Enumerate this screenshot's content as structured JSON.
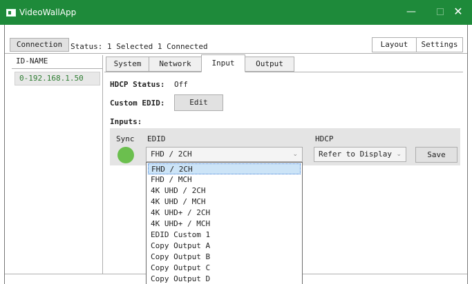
{
  "window": {
    "title": "VideoWallApp",
    "minimize": "—",
    "close": "✕"
  },
  "toolbar": {
    "connection_label": "Connection",
    "status_text": "Status: 1 Selected 1 Connected",
    "layout_label": "Layout",
    "settings_label": "Settings"
  },
  "device_list": {
    "header": "ID-NAME",
    "items": [
      {
        "label": "0-192.168.1.50"
      }
    ]
  },
  "tabs": [
    {
      "label": "System"
    },
    {
      "label": "Network"
    },
    {
      "label": "Input",
      "active": true
    },
    {
      "label": "Output"
    }
  ],
  "input_panel": {
    "hdcp_status_label": "HDCP Status:",
    "hdcp_status_value": "Off",
    "custom_edid_label": "Custom EDID:",
    "edit_label": "Edit",
    "inputs_label": "Inputs:",
    "sync_header": "Sync",
    "edid_header": "EDID",
    "hdcp_header": "HDCP",
    "sync_color": "#6bbf4e",
    "edid_value": "FHD / 2CH",
    "hdcp_value": "Refer to Display",
    "save_label": "Save"
  },
  "edid_options": [
    "FHD / 2CH",
    "FHD / MCH",
    "4K UHD / 2CH",
    "4K UHD / MCH",
    "4K UHD+ / 2CH",
    "4K UHD+ / MCH",
    "EDID Custom 1",
    "Copy Output A",
    "Copy Output B",
    "Copy Output C",
    "Copy Output D"
  ],
  "edid_selected_index": 0,
  "colors": {
    "titlebar": "#1e8a3a",
    "device_text": "#2e7d32",
    "selection": "#cce4f7"
  }
}
